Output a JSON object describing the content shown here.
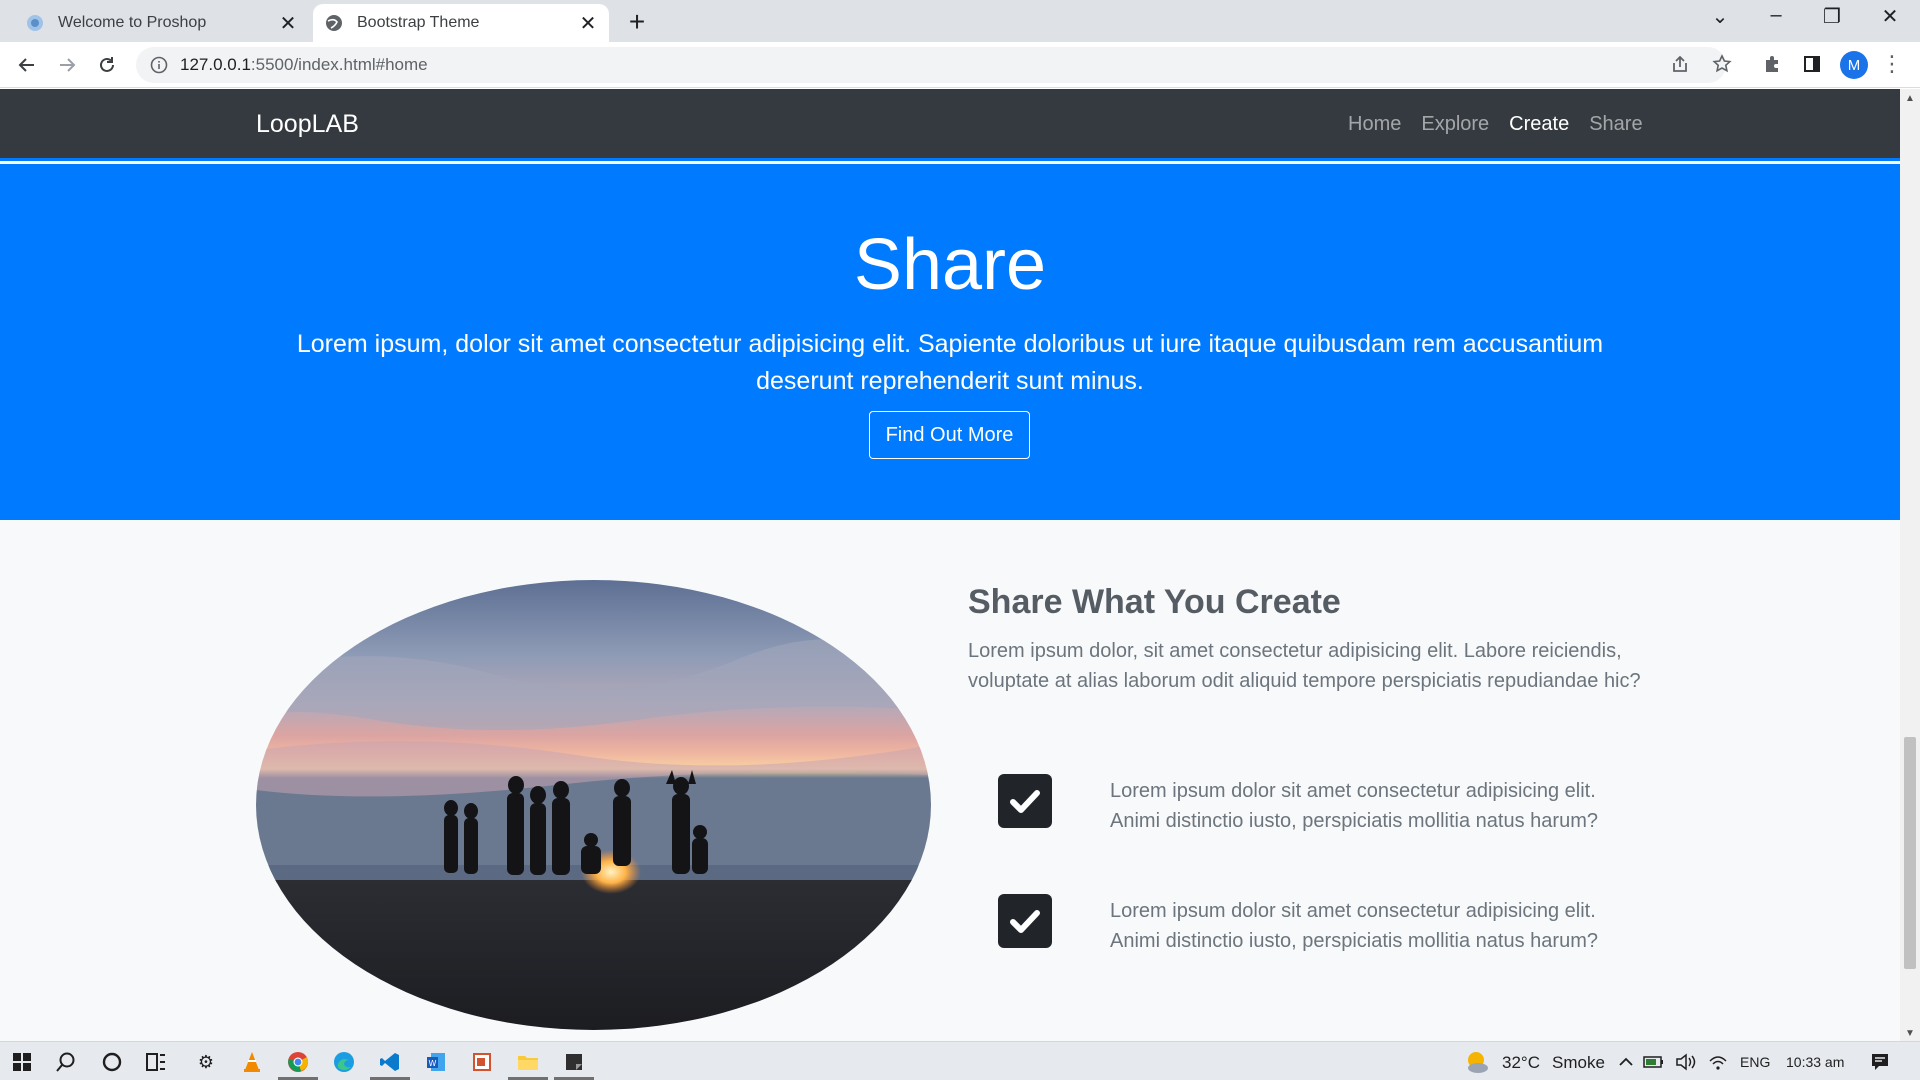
{
  "browser": {
    "tabs": [
      {
        "title": "Welcome to Proshop",
        "active": false
      },
      {
        "title": "Bootstrap Theme",
        "active": true
      }
    ],
    "url_host": "127.0.0.1",
    "url_rest": ":5500/index.html#home",
    "profile_initial": "M"
  },
  "site": {
    "brand": "LoopLAB",
    "nav": [
      "Home",
      "Explore",
      "Create",
      "Share"
    ],
    "active_nav": "Create"
  },
  "hero": {
    "title": "Share",
    "text": "Lorem ipsum, dolor sit amet consectetur adipisicing elit. Sapiente doloribus ut iure itaque quibusdam rem accusantium deserunt reprehenderit sunt minus.",
    "button": "Find Out More"
  },
  "section": {
    "heading": "Share What You Create",
    "lead": "Lorem ipsum dolor, sit amet consectetur adipisicing elit. Labore reiciendis, voluptate at alias laborum odit aliquid tempore perspiciatis repudiandae hic?",
    "features": [
      {
        "text": "Lorem ipsum dolor sit amet consectetur adipisicing elit. Animi distinctio iusto, perspiciatis mollitia natus harum?"
      },
      {
        "text": "Lorem ipsum dolor sit amet consectetur adipisicing elit. Animi distinctio iusto, perspiciatis mollitia natus harum?"
      }
    ]
  },
  "taskbar": {
    "weather_temp": "32°C",
    "weather_desc": "Smoke",
    "language": "ENG",
    "time": "10:33 am"
  },
  "colors": {
    "hero_blue": "#007bff",
    "navbar_dark": "#343a40"
  }
}
